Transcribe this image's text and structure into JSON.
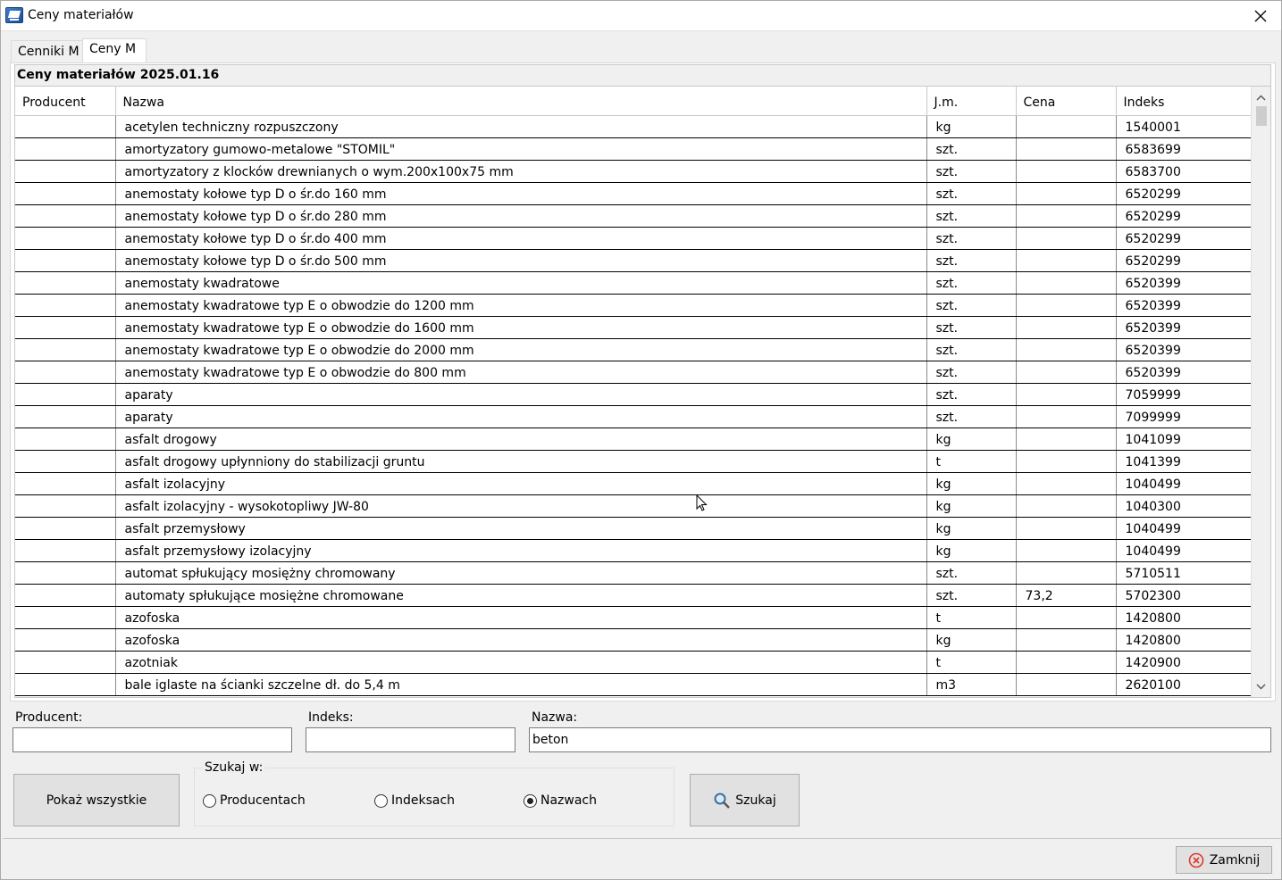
{
  "window": {
    "title": "Ceny materiałów"
  },
  "tabs": [
    {
      "label": "Cenniki M",
      "active": false
    },
    {
      "label": "Ceny M",
      "active": true
    }
  ],
  "grid": {
    "caption": "Ceny materiałów 2025.01.16",
    "columns": [
      "Producent",
      "Nazwa",
      "J.m.",
      "Cena",
      "Indeks"
    ],
    "rows": [
      [
        "",
        "acetylen techniczny rozpuszczony",
        "kg",
        "",
        "1540001"
      ],
      [
        "",
        "amortyzatory gumowo-metalowe \"STOMIL\"",
        "szt.",
        "",
        "6583699"
      ],
      [
        "",
        "amortyzatory z klocków drewnianych o wym.200x100x75 mm",
        "szt.",
        "",
        "6583700"
      ],
      [
        "",
        "anemostaty kołowe typ D o śr.do 160 mm",
        "szt.",
        "",
        "6520299"
      ],
      [
        "",
        "anemostaty kołowe typ D o śr.do 280 mm",
        "szt.",
        "",
        "6520299"
      ],
      [
        "",
        "anemostaty kołowe typ D o śr.do 400 mm",
        "szt.",
        "",
        "6520299"
      ],
      [
        "",
        "anemostaty kołowe typ D o śr.do 500 mm",
        "szt.",
        "",
        "6520299"
      ],
      [
        "",
        "anemostaty kwadratowe",
        "szt.",
        "",
        "6520399"
      ],
      [
        "",
        "anemostaty kwadratowe typ E o obwodzie do 1200 mm",
        "szt.",
        "",
        "6520399"
      ],
      [
        "",
        "anemostaty kwadratowe typ E o obwodzie do 1600 mm",
        "szt.",
        "",
        "6520399"
      ],
      [
        "",
        "anemostaty kwadratowe typ E o obwodzie do 2000 mm",
        "szt.",
        "",
        "6520399"
      ],
      [
        "",
        "anemostaty kwadratowe typ E o obwodzie do 800 mm",
        "szt.",
        "",
        "6520399"
      ],
      [
        "",
        "aparaty",
        "szt.",
        "",
        "7059999"
      ],
      [
        "",
        "aparaty",
        "szt.",
        "",
        "7099999"
      ],
      [
        "",
        "asfalt drogowy",
        "kg",
        "",
        "1041099"
      ],
      [
        "",
        "asfalt drogowy upłynniony do stabilizacji gruntu",
        "t",
        "",
        "1041399"
      ],
      [
        "",
        "asfalt izolacyjny",
        "kg",
        "",
        "1040499"
      ],
      [
        "",
        "asfalt izolacyjny - wysokotopliwy JW-80",
        "kg",
        "",
        "1040300"
      ],
      [
        "",
        "asfalt przemysłowy",
        "kg",
        "",
        "1040499"
      ],
      [
        "",
        "asfalt przemysłowy izolacyjny",
        "kg",
        "",
        "1040499"
      ],
      [
        "",
        "automat spłukujący mosiężny chromowany",
        "szt.",
        "",
        "5710511"
      ],
      [
        "",
        "automaty spłukujące mosiężne chromowane",
        "szt.",
        "73,2",
        "5702300"
      ],
      [
        "",
        "azofoska",
        "t",
        "",
        "1420800"
      ],
      [
        "",
        "azofoska",
        "kg",
        "",
        "1420800"
      ],
      [
        "",
        "azotniak",
        "t",
        "",
        "1420900"
      ],
      [
        "",
        "bale iglaste na ścianki szczelne dł. do 5,4 m",
        "m3",
        "",
        "2620100"
      ]
    ]
  },
  "search": {
    "producent_label": "Producent:",
    "producent_value": "",
    "indeks_label": "Indeks:",
    "indeks_value": "",
    "nazwa_label": "Nazwa:",
    "nazwa_value": "beton",
    "show_all_label": "Pokaż wszystkie",
    "search_in_label": "Szukaj w:",
    "radio_options": [
      {
        "label": "Producentach",
        "checked": false
      },
      {
        "label": "Indeksach",
        "checked": false
      },
      {
        "label": "Nazwach",
        "checked": true
      }
    ],
    "search_button_label": "Szukaj"
  },
  "footer": {
    "close_label": "Zamknij"
  },
  "colors": {
    "close_icon": "#e0392b",
    "accent": "#0078d7"
  }
}
